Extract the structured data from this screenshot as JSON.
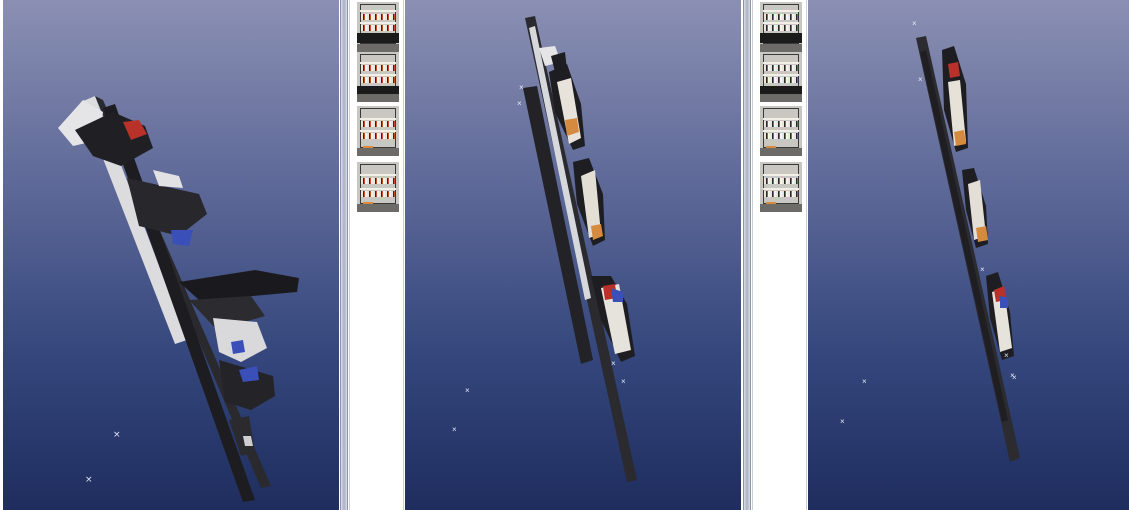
{
  "colors": {
    "viewport_top": "#8b90b3",
    "viewport_bottom": "#1f2d5e",
    "camera_marker": "#e6e9f5",
    "wall_light": "#dedfe2",
    "wall_dark": "#1e1e22",
    "accent_orange": "#d58b3f",
    "accent_red": "#b8322a",
    "accent_blue": "#3b4fb8"
  },
  "viewports": [
    {
      "name": "left-3d-view",
      "camera_markers": 2
    },
    {
      "name": "middle-3d-view",
      "camera_markers": 6
    },
    {
      "name": "right-3d-view",
      "camera_markers": 8
    }
  ],
  "thumbnail_strips": [
    {
      "name": "frame-strip-1",
      "count": 4
    },
    {
      "name": "frame-strip-2",
      "count": 4
    }
  ]
}
